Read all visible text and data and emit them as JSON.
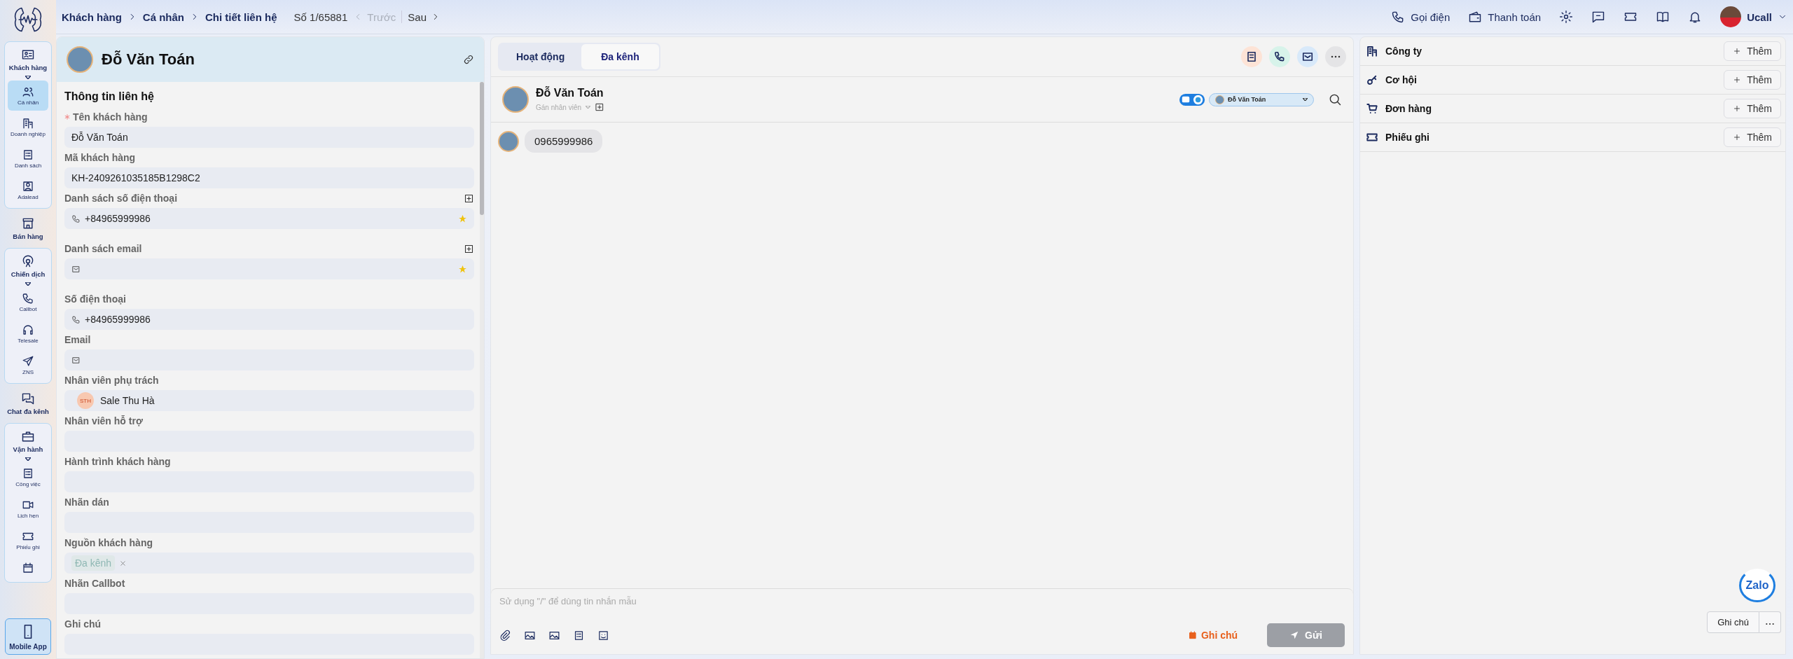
{
  "sidebar": {
    "items": [
      {
        "kind": "group",
        "label": "Khách hàng",
        "selected": false,
        "expanded": true,
        "children": [
          {
            "label": "Cá nhân",
            "selected": true
          },
          {
            "label": "Doanh nghiệp",
            "selected": false
          },
          {
            "label": "Danh sách",
            "selected": false
          },
          {
            "label": "Adalead",
            "selected": false
          }
        ]
      },
      {
        "kind": "single",
        "label": "Bán hàng",
        "selected": false
      },
      {
        "kind": "group",
        "label": "Chiến dịch",
        "selected": false,
        "expanded": true,
        "children": [
          {
            "label": "Callbot",
            "selected": false
          },
          {
            "label": "Telesale",
            "selected": false
          },
          {
            "label": "ZNS",
            "selected": false
          }
        ]
      },
      {
        "kind": "single",
        "label": "Chat đa kênh",
        "selected": false
      },
      {
        "kind": "group",
        "label": "Vận hành",
        "selected": false,
        "expanded": true,
        "children": [
          {
            "label": "Công việc",
            "selected": false
          },
          {
            "label": "Lịch hẹn",
            "selected": false
          },
          {
            "label": "Phiếu ghi",
            "selected": false
          },
          {
            "selected": false
          }
        ]
      }
    ],
    "mobile_app": {
      "label": "Mobile App"
    }
  },
  "topbar": {
    "breadcrumbs": [
      "Khách hàng",
      "Cá nhân",
      "Chi tiết liên hệ"
    ],
    "counter": "Số 1/65881",
    "prev": {
      "label": "Trước",
      "disabled": true
    },
    "next": {
      "label": "Sau",
      "disabled": false
    },
    "actions": [
      {
        "label": "Gọi điện"
      },
      {
        "label": "Thanh toán"
      }
    ],
    "user": {
      "name": "Ucall"
    }
  },
  "contact": {
    "name": "Đỗ Văn Toán",
    "section_title": "Thông tin liên hệ",
    "fields": [
      {
        "label": "Tên khách hàng",
        "kind": "text",
        "value": "Đỗ Văn Toán",
        "required": true,
        "addable": false,
        "starred": false
      },
      {
        "label": "Mã khách hàng",
        "kind": "text",
        "value": "KH-2409261035185B1298C2",
        "required": false,
        "addable": false,
        "starred": false
      },
      {
        "label": "Danh sách số điện thoại",
        "kind": "phone",
        "value": "+84965999986",
        "required": false,
        "addable": true,
        "starred": true
      },
      {
        "label": "Danh sách email",
        "kind": "email",
        "required": false,
        "addable": true,
        "starred": true
      },
      {
        "label": "Số điện thoại",
        "kind": "phone",
        "value": "+84965999986",
        "required": false,
        "addable": false,
        "starred": false
      },
      {
        "label": "Email",
        "kind": "email",
        "required": false,
        "addable": false,
        "starred": false
      },
      {
        "label": "Nhân viên phụ trách",
        "kind": "person",
        "initials": "STH",
        "value": "Sale Thu Hà",
        "required": false,
        "addable": false,
        "starred": false
      },
      {
        "label": "Nhân viên hỗ trợ",
        "kind": "text",
        "required": false,
        "addable": false,
        "starred": false
      },
      {
        "label": "Hành trình khách hàng",
        "kind": "text",
        "required": false,
        "addable": false,
        "starred": false
      },
      {
        "label": "Nhãn dán",
        "kind": "text",
        "required": false,
        "addable": false,
        "starred": false
      },
      {
        "label": "Nguồn khách hàng",
        "kind": "tag",
        "value": "Đa kênh",
        "required": false,
        "addable": false,
        "starred": false
      },
      {
        "label": "Nhãn Callbot",
        "kind": "text",
        "required": false,
        "addable": false,
        "starred": false
      },
      {
        "label": "Ghi chú",
        "kind": "text",
        "required": false,
        "addable": false,
        "starred": false
      }
    ]
  },
  "chat": {
    "tabs": [
      {
        "label": "Hoạt động",
        "selected": false
      },
      {
        "label": "Đa kênh",
        "selected": true
      }
    ],
    "name": "Đỗ Văn Toán",
    "assign_placeholder": "Gán nhân viên",
    "channel_account": "Đỗ Văn Toán",
    "messages": [
      {
        "text": "0965999986"
      }
    ],
    "composer_placeholder": "Sử dụng \"/\" để dùng tin nhắn mẫu",
    "note_button": "Ghi chú",
    "send": {
      "label": "Gửi",
      "disabled": true
    }
  },
  "related": {
    "sections": [
      {
        "title": "Công ty",
        "button": "Thêm"
      },
      {
        "title": "Cơ hội",
        "button": "Thêm"
      },
      {
        "title": "Đơn hàng",
        "button": "Thêm"
      },
      {
        "title": "Phiếu ghi",
        "button": "Thêm"
      }
    ],
    "note_button": "Ghi chú",
    "zalo_label": "Zalo"
  }
}
